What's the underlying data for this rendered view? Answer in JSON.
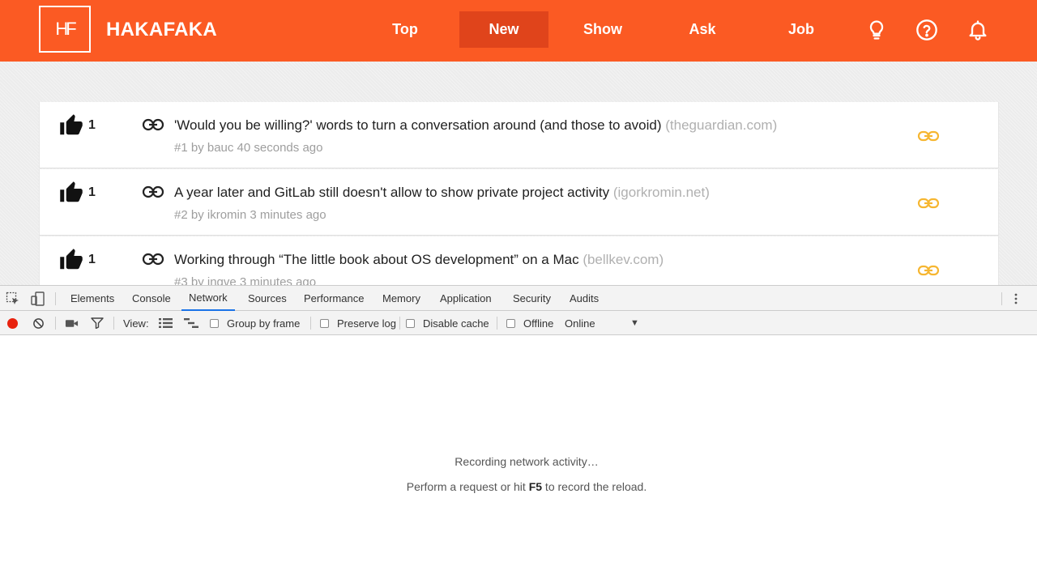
{
  "site": {
    "logo_text": "HF",
    "brand": "HAKAFAKA",
    "colors": {
      "header": "#fb5a23",
      "active_tab": "#e0441b",
      "link_accent": "#f6b631"
    },
    "nav": [
      {
        "label": "Top",
        "active": false
      },
      {
        "label": "New",
        "active": true
      },
      {
        "label": "Show",
        "active": false
      },
      {
        "label": "Ask",
        "active": false
      },
      {
        "label": "Job",
        "active": false
      }
    ],
    "header_icons": [
      "lightbulb-icon",
      "help-icon",
      "bell-icon"
    ],
    "stories": [
      {
        "votes": "1",
        "title": "'Would you be willing?' words to turn a conversation around (and those to avoid)",
        "domain": "(theguardian.com)",
        "meta": "#1 by bauc 40 seconds ago"
      },
      {
        "votes": "1",
        "title": "A year later and GitLab still doesn't allow to show private project activity",
        "domain": "(igorkromin.net)",
        "meta": "#2 by ikromin 3 minutes ago"
      },
      {
        "votes": "1",
        "title": "Working through “The little book about OS development” on a Mac",
        "domain": "(bellkev.com)",
        "meta": "#3 by ingve 3 minutes ago"
      }
    ]
  },
  "devtools": {
    "tabs": [
      "Elements",
      "Console",
      "Network",
      "Sources",
      "Performance",
      "Memory",
      "Application",
      "Security",
      "Audits"
    ],
    "active_tab": "Network",
    "toolbar": {
      "view_label": "View:",
      "group_by_frame": "Group by frame",
      "preserve_log": "Preserve log",
      "disable_cache": "Disable cache",
      "offline": "Offline",
      "throttling": "Online"
    },
    "message": {
      "line1": "Recording network activity…",
      "line2_before": "Perform a request or hit ",
      "line2_key": "F5",
      "line2_after": " to record the reload."
    },
    "colors": {
      "record": "#e8220e",
      "active_underline": "#1a73e8"
    }
  }
}
